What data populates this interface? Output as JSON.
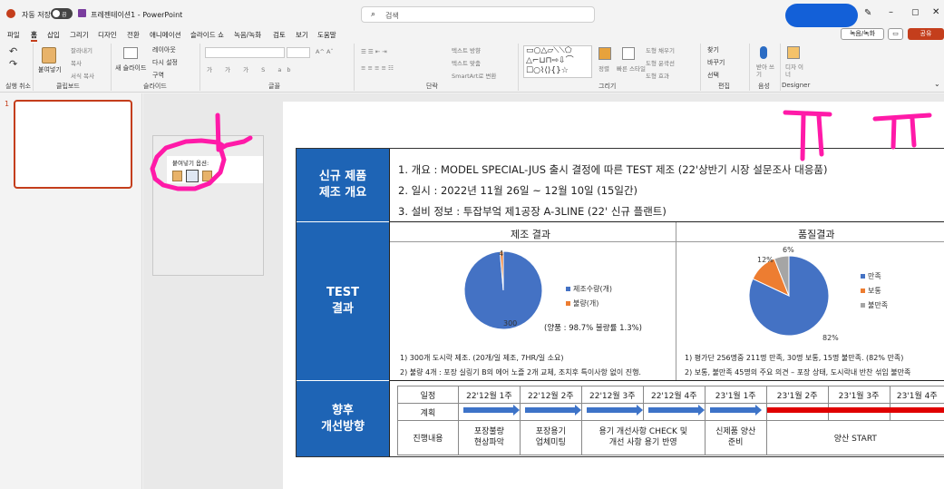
{
  "titlebar": {
    "autosave_label": "자동 저장",
    "toggle_state": "끔",
    "file_name": "프레젠테이션1  -  PowerPoint",
    "search_placeholder": "검색"
  },
  "menu": {
    "tabs": [
      "파일",
      "홈",
      "삽입",
      "그리기",
      "디자인",
      "전환",
      "애니메이션",
      "슬라이드 쇼",
      "녹음/녹화",
      "검토",
      "보기",
      "도움말"
    ],
    "active_tab": "홈",
    "record_button": "녹음/녹화",
    "share_button": "공유"
  },
  "ribbon": {
    "groups": [
      "실행 취소",
      "클립보드",
      "슬라이드",
      "글꼴",
      "단락",
      "그리기",
      "편집",
      "음성",
      "Designer"
    ],
    "clipboard": {
      "paste": "붙여넣기",
      "cut": "잘라내기",
      "copy": "복사",
      "format_painter": "서식 복사"
    },
    "slides": {
      "new_slide": "새 슬라이드",
      "layout": "레이아웃",
      "reset": "다시 설정",
      "section": "구역"
    },
    "paragraph": {
      "text_direction": "텍스트 방향",
      "align_text": "텍스트 맞춤",
      "smartart": "SmartArt로 변환"
    },
    "drawing": {
      "arrange": "정렬",
      "quick_styles": "빠른 스타일",
      "shape_fill": "도형 채우기",
      "shape_outline": "도형 윤곽선",
      "shape_effects": "도형 효과"
    },
    "editing": {
      "find": "찾기",
      "replace": "바꾸기",
      "select": "선택"
    },
    "voice": {
      "dictate": "받아 쓰기"
    },
    "designer": {
      "designer": "디자 이너"
    }
  },
  "slide_pane": {
    "slide_number": "1"
  },
  "paste_popup": {
    "title": "붙여넣기 옵션:"
  },
  "slide": {
    "sec1_header": "신규 제품\n제조 개요",
    "overview_lines": [
      "1. 개요 : MODEL SPECIAL-JUS 출시 결정에 따른 TEST 제조 (22'상반기 시장 설문조사 대응품)",
      "2. 일시 : 2022년 11월 26일 ~ 12월 10일 (15일간)",
      "3. 설비 정보 : 투잡부엌 제1공장 A-3LINE (22' 신규 플랜트)"
    ],
    "sec2_header": "TEST\n결과",
    "mfg_title": "제조 결과",
    "quality_title": "품질결과",
    "mfg_note": "(양품 : 98.7% 불량률 1.3%)",
    "mfg_bullets": [
      "1) 300개 도시락 제조. (20개/일 제조, 7HR/일 소요)",
      "2) 불량 4개 : 포장 실링기 B의 에어 노즐 2개 교체, 조치후 특이사항 없이 진행."
    ],
    "quality_bullets": [
      "1) 평가단 256명중 211명 만족, 30명 보통, 15명 불만족. (82% 만족)",
      "2) 보통, 불만족 45명의 주요 의견 – 포장 상태, 도시락내 반찬 섞임 불만족"
    ],
    "sec3_header": "향후\n개선방향",
    "schedule": {
      "row_label_schedule": "일정",
      "row_label_plan": "계획",
      "row_label_content": "진행내용",
      "periods": [
        "22'12월 1주",
        "22'12월 2주",
        "22'12월 3주",
        "22'12월 4주",
        "23'1월 1주",
        "23'1월 2주",
        "23'1월 3주",
        "23'1월 4주"
      ],
      "contents": [
        "포장불량\n현상파악",
        "포장용기\n업체미팅",
        "용기 개선사항 CHECK 및\n개선 사항 용기 반영",
        "신제품 양산\n준비",
        "양산 START"
      ]
    }
  },
  "chart_data": [
    {
      "type": "pie",
      "title": "제조 결과",
      "categories": [
        "제조수량(개)",
        "불량(개)"
      ],
      "values": [
        300,
        4
      ],
      "data_labels": [
        "300",
        "4"
      ],
      "colors": [
        "#4472c4",
        "#ed7d31"
      ],
      "legend": "right"
    },
    {
      "type": "pie",
      "title": "품질결과",
      "categories": [
        "만족",
        "보통",
        "불만족"
      ],
      "values": [
        82,
        12,
        6
      ],
      "data_labels": [
        "82%",
        "12%",
        "6%"
      ],
      "colors": [
        "#4472c4",
        "#ed7d31",
        "#a5a5a5"
      ],
      "legend": "right"
    }
  ],
  "colors": {
    "accent": "#c43e1c",
    "header_blue": "#1e64b5",
    "annotation": "#ff1aa8",
    "plan_red": "#e00000"
  }
}
